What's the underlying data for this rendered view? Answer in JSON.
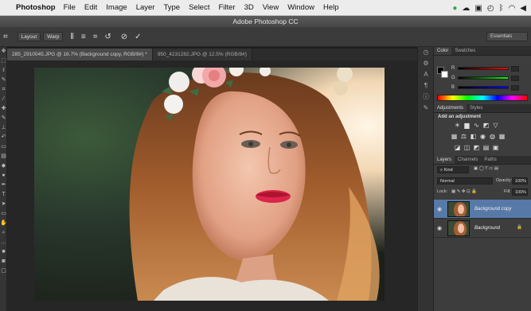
{
  "menubar": {
    "app_name": "Photoshop",
    "items": [
      "File",
      "Edit",
      "Image",
      "Layer",
      "Type",
      "Select",
      "Filter",
      "3D",
      "View",
      "Window",
      "Help"
    ]
  },
  "window": {
    "title": "Adobe Photoshop CC"
  },
  "options_bar": {
    "layout_label": "Layout",
    "warp_label": "Warp",
    "workspace": "Essentials"
  },
  "tabs": [
    {
      "label": "285_2910045.JPG @ 16.7% (Background copy, RGB/8#) *",
      "active": true
    },
    {
      "label": "950_4231282.JPG @ 12.5% (RGB/8#)",
      "active": false
    }
  ],
  "panels": {
    "color": {
      "tabs": [
        "Color",
        "Swatches"
      ],
      "channels": [
        "R",
        "G",
        "B"
      ]
    },
    "adjustments": {
      "tabs": [
        "Adjustments",
        "Styles"
      ],
      "heading": "Add an adjustment"
    },
    "layers": {
      "tabs": [
        "Layers",
        "Channels",
        "Paths"
      ],
      "filter_kind": "Kind",
      "blend_mode": "Normal",
      "opacity_label": "Opacity:",
      "opacity_value": "100%",
      "lock_label": "Lock:",
      "fill_label": "Fill:",
      "fill_value": "100%",
      "items": [
        {
          "name": "Background copy",
          "selected": true
        },
        {
          "name": "Background",
          "selected": false
        }
      ]
    }
  },
  "colors": {
    "selection": "#5779a8",
    "panel": "#3d3d3d",
    "menubar": "#ececec"
  }
}
